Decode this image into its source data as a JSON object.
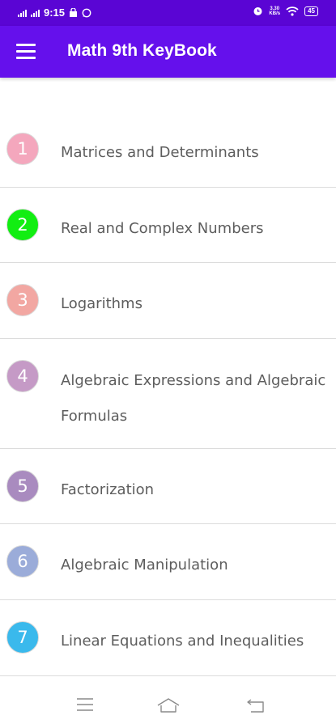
{
  "status_bar": {
    "time": "9:15",
    "speed_value": "3.30",
    "speed_unit": "KB/s",
    "battery": "45"
  },
  "app_bar": {
    "title": "Math 9th KeyBook"
  },
  "chapters": [
    {
      "number": "1",
      "title": "Matrices and Determinants",
      "color": "#f4a7bd"
    },
    {
      "number": "2",
      "title": "Real and Complex Numbers",
      "color": "#12ee12"
    },
    {
      "number": "3",
      "title": "Logarithms",
      "color": "#f2a7a2"
    },
    {
      "number": "4",
      "title": "Algebraic Expressions and Algebraic Formulas",
      "color": "#c59ac6"
    },
    {
      "number": "5",
      "title": "Factorization",
      "color": "#a98bbf"
    },
    {
      "number": "6",
      "title": "Algebraic Manipulation",
      "color": "#9bacd9"
    },
    {
      "number": "7",
      "title": "Linear Equations and Inequalities",
      "color": "#3ab9ec"
    }
  ],
  "nav_bar": {
    "icons": [
      "menu-icon",
      "home-icon",
      "back-icon"
    ]
  }
}
